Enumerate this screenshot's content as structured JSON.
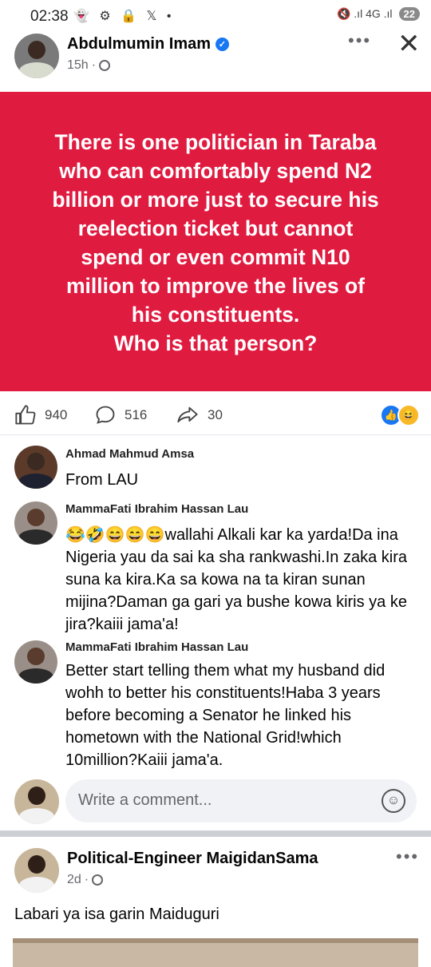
{
  "status_bar": {
    "time": "02:38",
    "left_icons": "👻 ⚙ 🔒 𝕏 •",
    "signal": "🔇 .ıl 4G .ıl",
    "battery": "22"
  },
  "post": {
    "author": "Abdulmumin Imam",
    "time": "15h",
    "more_icon": "more-dots-icon",
    "close_icon": "close-icon",
    "banner_text": "There is one politician in Taraba\nwho can comfortably spend N2\nbillion or more just to secure his\nreelection ticket but cannot\nspend or even commit N10\nmillion to improve the lives of\nhis constituents.\nWho is that person?",
    "banner_color": "#e01b40",
    "reactions": {
      "likes": "940",
      "comments": "516",
      "shares": "30"
    }
  },
  "comments": [
    {
      "name": "Ahmad Mahmud Amsa",
      "text": "From LAU"
    },
    {
      "name": "MammaFati Ibrahim Hassan Lau",
      "text": "😂🤣😄😄😄wallahi Alkali kar ka yarda!Da ina Nigeria yau da sai ka sha rankwashi.In zaka kira suna ka kira.Ka sa kowa na ta kiran sunan mijina?Daman ga gari ya bushe kowa kiris ya ke jira?kaiii jama'a!"
    },
    {
      "name": "MammaFati Ibrahim Hassan Lau",
      "text": "Better start telling them what my husband did wohh to better his constituents!Haba 3 years before becoming a Senator he linked his hometown with the National Grid!which 10million?Kaiii jama'a."
    }
  ],
  "composer": {
    "placeholder": "Write a comment..."
  },
  "next_post": {
    "author": "Political-Engineer MaigidanSama",
    "time": "2d",
    "text": "Labari ya isa garin Maiduguri"
  },
  "colors": {
    "accent": "#1877f2",
    "secondary_text": "#65676b"
  }
}
